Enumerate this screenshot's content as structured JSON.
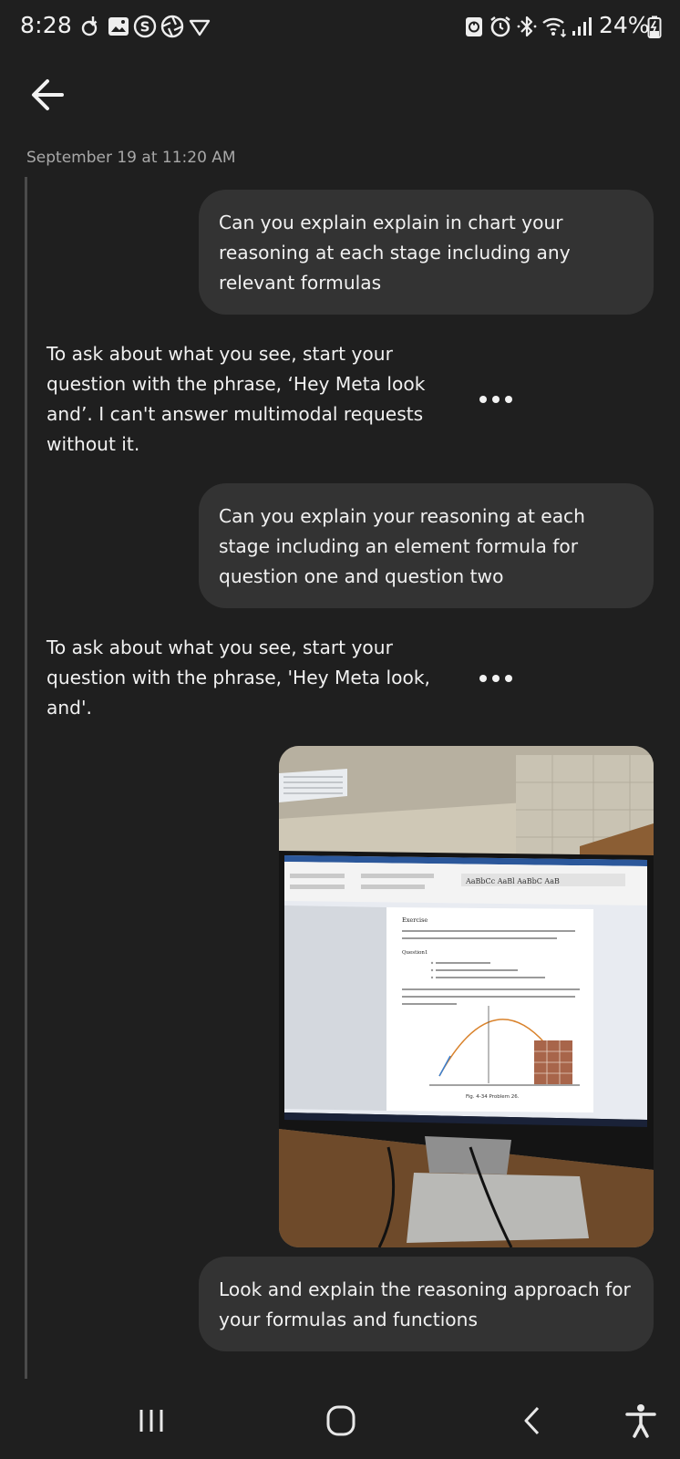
{
  "status_bar": {
    "time": "8:28",
    "battery": "24%"
  },
  "conversation": {
    "timestamp": "September 19 at 11:20 AM",
    "messages": [
      {
        "role": "user",
        "text": "Can you explain explain in chart your reasoning at each stage including any relevant formulas"
      },
      {
        "role": "assistant",
        "text": "To ask about what you see, start your question with the phrase, ‘Hey Meta look and’. I can't answer multimodal requests without it."
      },
      {
        "role": "user",
        "text": "Can you explain your reasoning at each stage including an element formula for question one and question two"
      },
      {
        "role": "assistant",
        "text": "To ask about what you see, start your question with the phrase, 'Hey Meta look, and'."
      },
      {
        "role": "user",
        "text": "Look and explain the reasoning approach for your formulas and functions"
      }
    ]
  },
  "photo": {
    "document_heading": "Exercise",
    "document_subheading": "Question1",
    "figure_caption": "Fig. 4-34   Problem 26."
  },
  "colors": {
    "background": "#1f1f1f",
    "bubble": "#333333",
    "text": "#f1f1f1",
    "muted": "#a8a8a8",
    "thread_line": "#4b4b4b"
  }
}
